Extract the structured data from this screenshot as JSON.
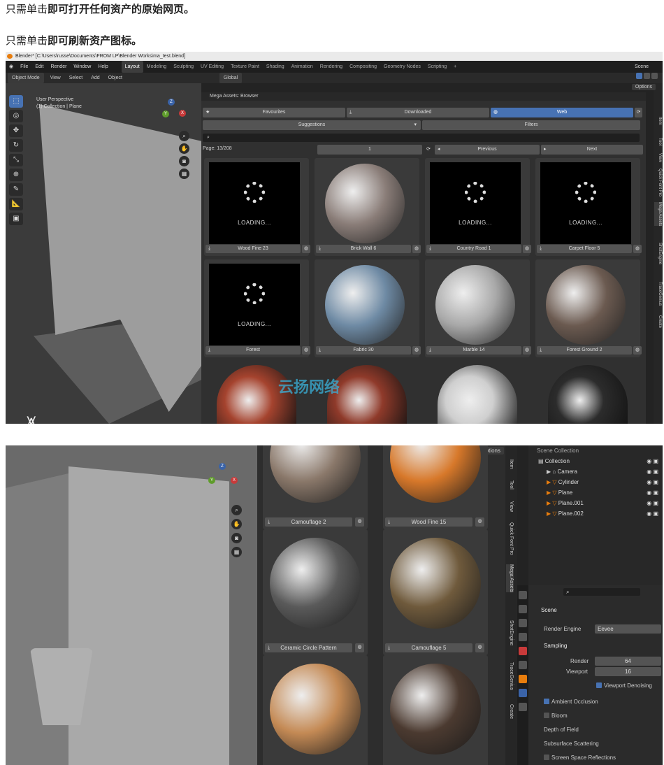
{
  "captions": {
    "c1_prefix": "只需单击",
    "c1_bold": "即可打开任何资产的原始网页。",
    "c2_prefix": "只需单击",
    "c2_bold": "即可刷新资产图标。"
  },
  "window": {
    "title": "Blender* [C:\\Users\\russe\\Documents\\FROM LP\\Blender Works\\ma_test.blend]"
  },
  "menu": [
    "File",
    "Edit",
    "Render",
    "Window",
    "Help"
  ],
  "workspaces": [
    "Layout",
    "Modeling",
    "Sculpting",
    "UV Editing",
    "Texture Paint",
    "Shading",
    "Animation",
    "Rendering",
    "Compositing",
    "Geometry Nodes",
    "Scripting"
  ],
  "scene_label": "Scene",
  "header": {
    "mode": "Object Mode",
    "items": [
      "View",
      "Select",
      "Add",
      "Object"
    ],
    "orientation": "Global",
    "options": "Options"
  },
  "viewport": {
    "perspective": "User Perspective",
    "collection": "(1) Collection | Plane"
  },
  "browser": {
    "title": "Mega Assets: Browser",
    "tabs": [
      "Favourites",
      "Downloaded",
      "Web"
    ],
    "suggestions": "Suggestions",
    "filters": "Filters",
    "page_info": "Page: 13/208",
    "page_value": "1",
    "previous": "Previous",
    "next": "Next",
    "loading_text": "LOADING...",
    "assets": [
      {
        "name": "Wood Fine 23",
        "loading": true
      },
      {
        "name": "Brick Wall 6",
        "loading": false,
        "color": "#8a7d78"
      },
      {
        "name": "Country Road 1",
        "loading": true
      },
      {
        "name": "Carpet Floor 5",
        "loading": true
      },
      {
        "name": "Forest",
        "loading": true
      },
      {
        "name": "Fabric 30",
        "loading": false,
        "color": "#6e8aa4"
      },
      {
        "name": "Marble 14",
        "loading": false,
        "color": "#a8a8a8"
      },
      {
        "name": "Forest Ground 2",
        "loading": false,
        "color": "#6b5a50"
      }
    ]
  },
  "side_tabs": [
    "Item",
    "Tool",
    "View",
    "Quick Font Pro",
    "Mega Assets",
    "ShotEngine",
    "TraceGenius",
    "Create"
  ],
  "watermark": "云扬网络",
  "shot2": {
    "options": "Options",
    "assets": [
      {
        "name": "Camouflage 2",
        "color": "#8a786a"
      },
      {
        "name": "Wood Fine 15",
        "color": "#d7782a"
      },
      {
        "name": "Ceramic Circle Pattern",
        "color": "#5a5a5a"
      },
      {
        "name": "Camouflage 5",
        "color": "#6f5a3c"
      },
      {
        "name": "",
        "color": "#c48a55"
      },
      {
        "name": "",
        "color": "#4b3a30"
      }
    ],
    "outliner": {
      "title": "Scene Collection",
      "collection": "Collection",
      "items": [
        "Camera",
        "Cylinder",
        "Plane",
        "Plane.001",
        "Plane.002"
      ]
    },
    "props": {
      "scene": "Scene",
      "render_engine_label": "Render Engine",
      "render_engine": "Eevee",
      "sampling": "Sampling",
      "render_label": "Render",
      "render_value": "64",
      "viewport_label": "Viewport",
      "viewport_value": "16",
      "viewport_denoising": "Viewport Denoising",
      "sections": [
        "Ambient Occlusion",
        "Bloom",
        "Depth of Field",
        "Subsurface Scattering",
        "Screen Space Reflections"
      ]
    }
  }
}
